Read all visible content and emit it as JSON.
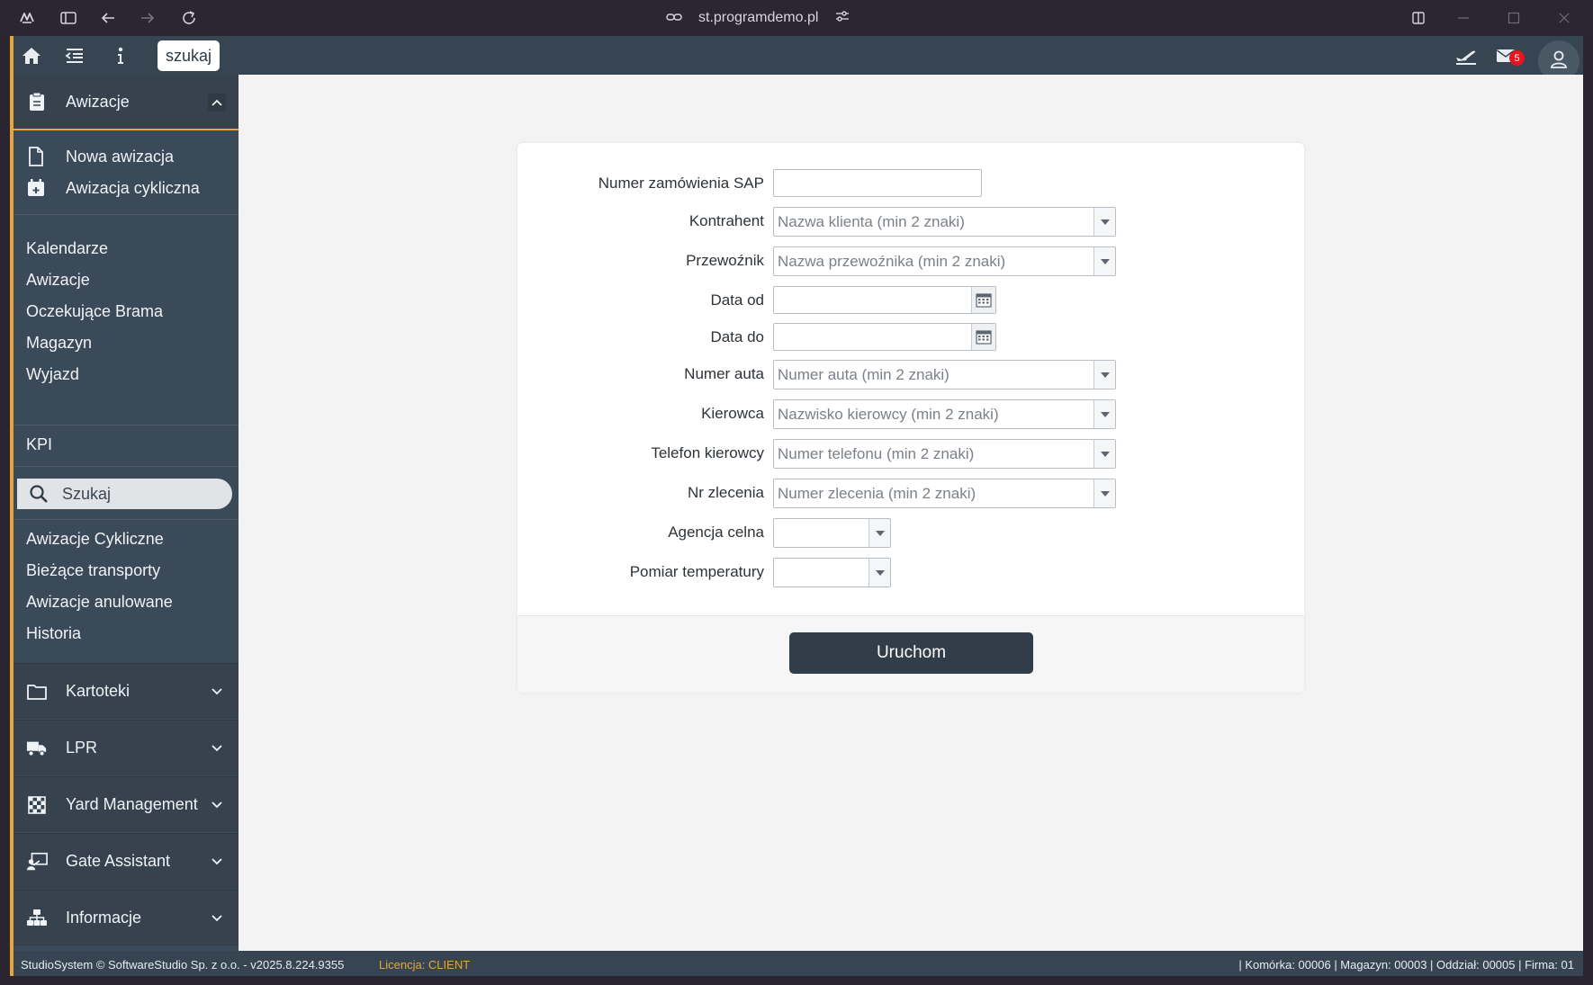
{
  "browser": {
    "url": "st.programdemo.pl"
  },
  "topbar": {
    "search_pill": "szukaj",
    "mail_count": "5"
  },
  "sidebar": {
    "awizacje_section": {
      "title": "Awizacje",
      "actions": [
        "Nowa awizacja",
        "Awizacja cykliczna"
      ],
      "links": [
        "Kalendarze",
        "Awizacje",
        "Oczekujące Brama",
        "Magazyn",
        "Wyjazd"
      ],
      "kpi": "KPI",
      "search_label": "Szukaj",
      "more_links": [
        "Awizacje Cykliczne",
        "Bieżące transporty",
        "Awizacje anulowane",
        "Historia"
      ]
    },
    "sections": [
      "Kartoteki",
      "LPR",
      "Yard Management",
      "Gate Assistant",
      "Informacje"
    ]
  },
  "form": {
    "fields": [
      {
        "label": "Numer zamówienia SAP",
        "placeholder": ""
      },
      {
        "label": "Kontrahent",
        "placeholder": "Nazwa klienta (min 2 znaki)"
      },
      {
        "label": "Przewoźnik",
        "placeholder": "Nazwa przewoźnika (min 2 znaki)"
      },
      {
        "label": "Data od",
        "placeholder": ""
      },
      {
        "label": "Data do",
        "placeholder": ""
      },
      {
        "label": "Numer auta",
        "placeholder": "Numer auta (min 2 znaki)"
      },
      {
        "label": "Kierowca",
        "placeholder": "Nazwisko kierowcy (min 2 znaki)"
      },
      {
        "label": "Telefon kierowcy",
        "placeholder": "Numer telefonu (min 2 znaki)"
      },
      {
        "label": "Nr zlecenia",
        "placeholder": "Numer zlecenia (min 2 znaki)"
      },
      {
        "label": "Agencja celna",
        "placeholder": ""
      },
      {
        "label": "Pomiar temperatury",
        "placeholder": ""
      }
    ],
    "run_button": "Uruchom"
  },
  "status": {
    "left": "StudioSystem © SoftwareStudio Sp. z o.o. - v2025.8.224.9355",
    "license": "Licencja: CLIENT",
    "right": "| Komórka: 00006 | Magazyn: 00003 | Oddział: 00005 | Firma: 01"
  },
  "colors": {
    "accent": "#e9a43a",
    "sidebar": "#3b4a59",
    "topbar": "#374552",
    "button": "#313d49",
    "badge": "#e5161f"
  }
}
